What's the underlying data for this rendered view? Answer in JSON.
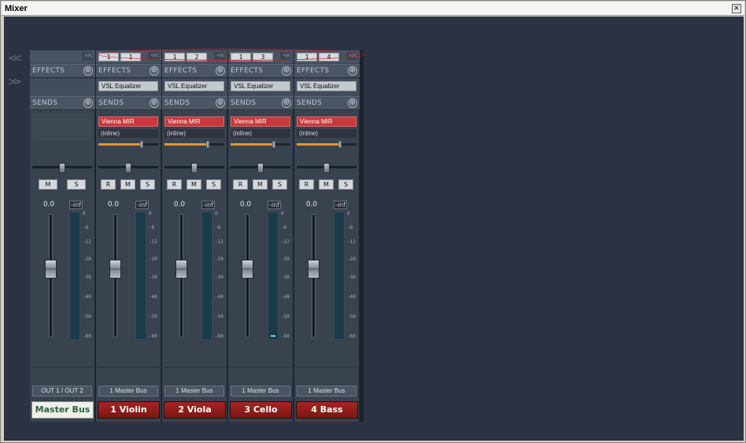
{
  "window": {
    "title": "Mixer",
    "close_icon": "×"
  },
  "nav": {
    "left_arrows": "<<",
    "right_arrows": ">>"
  },
  "labels": {
    "effects": "EFFECTS",
    "sends": "SENDS",
    "plus": "⊕",
    "collapse": "<<",
    "mute": "M",
    "solo": "S",
    "record": "R"
  },
  "scale": [
    "0",
    "-6",
    "-12",
    "-20",
    "-30",
    "-40",
    "-50",
    "-60"
  ],
  "master": {
    "name": "Master Bus",
    "volume": "0.0",
    "peak": "-inf",
    "output": "OUT 1 / OUT 2",
    "pan": 0.5
  },
  "channels": [
    {
      "in": "1",
      "out": "1",
      "effect": "VSL Equalizer",
      "send": "Vienna MIR",
      "send_mode": "(inline)",
      "send_level": 0.72,
      "pan": 0.5,
      "volume": "0.0",
      "peak": "-inf",
      "output": "1 Master Bus",
      "name": "1 Violin",
      "meter": 0
    },
    {
      "in": "1",
      "out": "2",
      "effect": "VSL Equalizer",
      "send": "Vienna MIR",
      "send_mode": "(inline)",
      "send_level": 0.72,
      "pan": 0.5,
      "volume": "0.0",
      "peak": "-inf",
      "output": "1 Master Bus",
      "name": "2 Viola",
      "meter": 0
    },
    {
      "in": "1",
      "out": "3",
      "effect": "VSL Equalizer",
      "send": "Vienna MIR",
      "send_mode": "(inline)",
      "send_level": 0.72,
      "pan": 0.5,
      "volume": "0.0",
      "peak": "-inf",
      "output": "1 Master Bus",
      "name": "3 Cello",
      "meter": 0.02
    },
    {
      "in": "1",
      "out": "4",
      "effect": "VSL Equalizer",
      "send": "Vienna MIR",
      "send_mode": "(inline)",
      "send_level": 0.72,
      "pan": 0.5,
      "volume": "0.0",
      "peak": "-inf",
      "output": "1 Master Bus",
      "name": "4 Bass",
      "meter": 0
    }
  ],
  "colors": {
    "background": "#2b3241",
    "strip": "#39424f",
    "send_slot": "#c8383c",
    "track_name": "#8c1c19",
    "master_name": "#eff0ea",
    "highlight_circle": "#d12020"
  }
}
